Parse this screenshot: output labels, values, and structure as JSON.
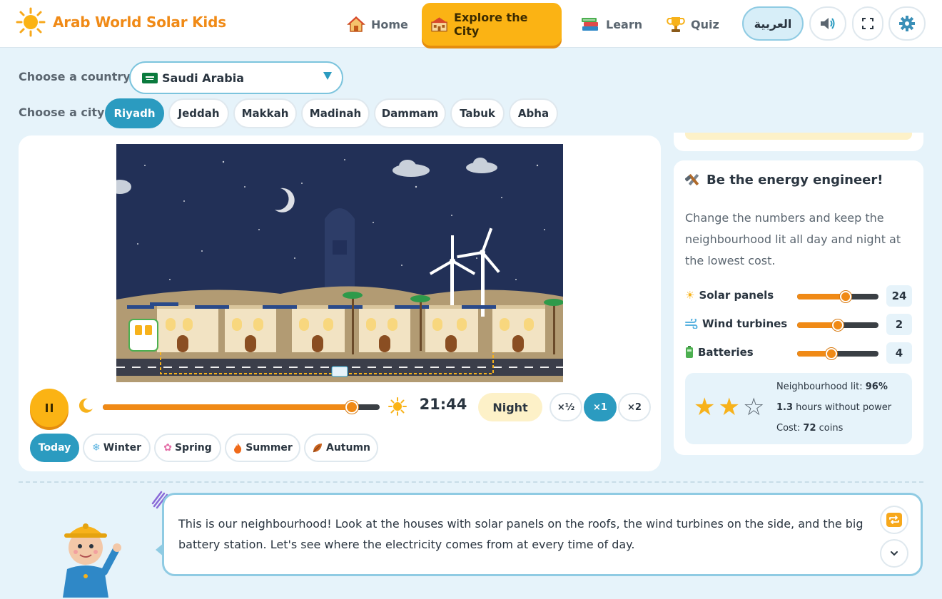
{
  "app": {
    "title": "Arab World Solar Kids"
  },
  "nav": [
    {
      "label": "Home",
      "icon": "home-icon"
    },
    {
      "label": "Explore the City",
      "icon": "city-icon",
      "active": true
    },
    {
      "label": "Learn",
      "icon": "books-icon"
    },
    {
      "label": "Quiz",
      "icon": "trophy-icon"
    }
  ],
  "header_buttons": {
    "language": "العربية",
    "icons": [
      "speaker-icon",
      "fullscreen-icon",
      "gear-icon"
    ]
  },
  "selectors": {
    "country_label": "Choose a country",
    "country_value": "Saudi Arabia",
    "city_label": "Choose a city",
    "cities": [
      "Riyadh",
      "Jeddah",
      "Makkah",
      "Madinah",
      "Dammam",
      "Tabuk",
      "Abha"
    ],
    "selected_city": "Riyadh"
  },
  "player": {
    "time": "21:44",
    "phase": "Night",
    "progress": 0.9,
    "speeds": [
      "×½",
      "×1",
      "×2"
    ],
    "active_speed": "×1",
    "seasons": [
      {
        "label": "Today",
        "icon": ""
      },
      {
        "label": "Winter",
        "icon": "snowflake-icon"
      },
      {
        "label": "Spring",
        "icon": "blossom-icon"
      },
      {
        "label": "Summer",
        "icon": "fire-icon"
      },
      {
        "label": "Autumn",
        "icon": "leaf-icon"
      }
    ],
    "active_season": "Today"
  },
  "engineer": {
    "title": "Be the energy engineer!",
    "description": "Change the numbers and keep the neighbourhood lit all day and night at the lowest cost.",
    "controls": [
      {
        "label": "Solar panels",
        "icon": "sun-icon",
        "value": 24,
        "level": 0.6
      },
      {
        "label": "Wind turbines",
        "icon": "wind-icon",
        "value": 2,
        "level": 0.5
      },
      {
        "label": "Batteries",
        "icon": "battery-icon",
        "value": 4,
        "level": 0.42
      }
    ],
    "results": {
      "stars": 2,
      "max_stars": 3,
      "lit_label": "Neighbourhood lit:",
      "lit_value": "96%",
      "hours_value": "1.3",
      "hours_label": "hours without power",
      "cost_label": "Cost:",
      "cost_value": "72",
      "cost_unit": "coins"
    }
  },
  "guide": {
    "text": "This is our neighbourhood! Look at the houses with solar panels on the roofs, the wind turbines on the side, and the big battery station. Let's see where the electricity comes from at every time of day."
  },
  "colors": {
    "accent": "#2b9bc0",
    "brand": "#f08a16",
    "night_sky": "#223057",
    "gold": "#fbb314"
  }
}
